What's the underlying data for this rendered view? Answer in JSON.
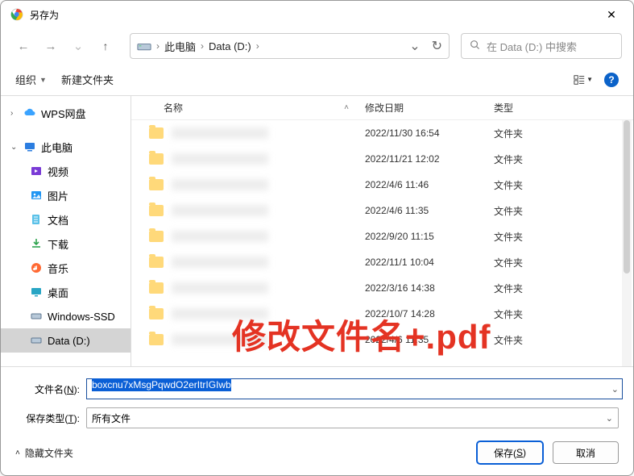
{
  "title": "另存为",
  "breadcrumb": {
    "root": "此电脑",
    "location": "Data (D:)"
  },
  "search": {
    "placeholder": "在 Data (D:) 中搜索"
  },
  "toolbar": {
    "organize": "组织",
    "newfolder": "新建文件夹"
  },
  "columns": {
    "name": "名称",
    "date": "修改日期",
    "type": "类型"
  },
  "sidebar": {
    "wps": "WPS网盘",
    "pc": "此电脑",
    "video": "视频",
    "pictures": "图片",
    "documents": "文档",
    "downloads": "下载",
    "music": "音乐",
    "desktop": "桌面",
    "winssd": "Windows-SSD",
    "datad": "Data (D:)"
  },
  "files": [
    {
      "date": "2022/11/30 16:54",
      "type": "文件夹"
    },
    {
      "date": "2022/11/21 12:02",
      "type": "文件夹"
    },
    {
      "date": "2022/4/6 11:46",
      "type": "文件夹"
    },
    {
      "date": "2022/4/6 11:35",
      "type": "文件夹"
    },
    {
      "date": "2022/9/20 11:15",
      "type": "文件夹"
    },
    {
      "date": "2022/11/1 10:04",
      "type": "文件夹"
    },
    {
      "date": "2022/3/16 14:38",
      "type": "文件夹"
    },
    {
      "date": "2022/10/7 14:28",
      "type": "文件夹"
    },
    {
      "date": "2022/4/6 11:35",
      "type": "文件夹"
    }
  ],
  "overlay": "修改文件名+.pdf",
  "form": {
    "filename_label_pre": "文件名(",
    "filename_label_u": "N",
    "filename_label_post": "):",
    "filename_value": "boxcnu7xMsgPqwdO2erItrIGIwb",
    "filetype_label_pre": "保存类型(",
    "filetype_label_u": "T",
    "filetype_label_post": "):",
    "filetype_value": "所有文件"
  },
  "footer": {
    "hide": "隐藏文件夹",
    "save_pre": "保存(",
    "save_u": "S",
    "save_post": ")",
    "cancel": "取消"
  }
}
